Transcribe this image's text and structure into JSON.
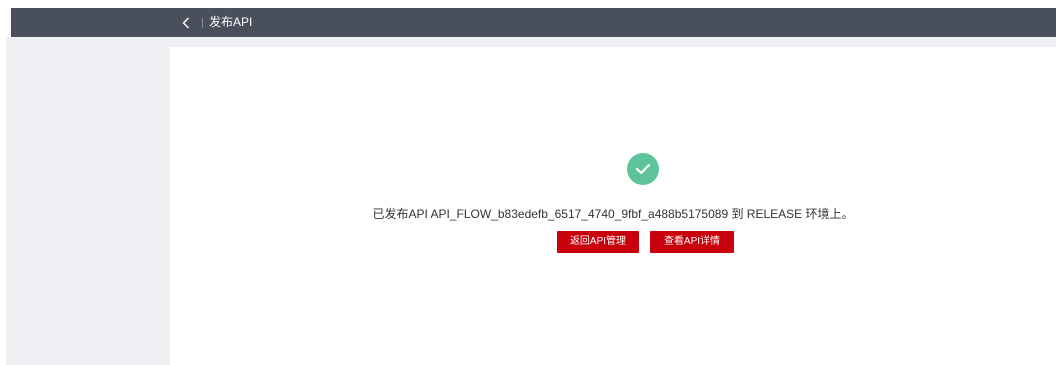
{
  "header": {
    "title": "发布API",
    "back_icon": "chevron-left-icon"
  },
  "result": {
    "icon": "check-circle-icon",
    "status_color": "#5cc39a",
    "message": "已发布API API_FLOW_b83edefb_6517_4740_9fbf_a488b5175089 到 RELEASE 环境上。"
  },
  "actions": {
    "back_to_manage_label": "返回API管理",
    "view_detail_label": "查看API详情",
    "primary_color": "#c7000b"
  },
  "colors": {
    "topbar": "#4a4f5c",
    "workspace": "#eef0f4"
  }
}
